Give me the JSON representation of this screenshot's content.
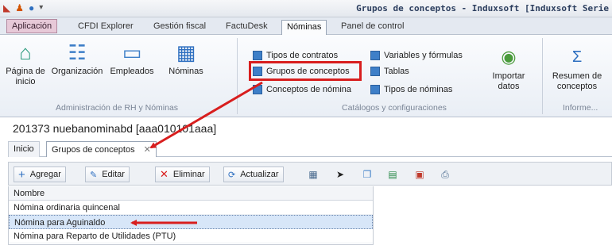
{
  "window": {
    "title": "Grupos de conceptos - Induxsoft [Induxsoft Serie"
  },
  "ribbon_tabs": [
    "Aplicación",
    "CFDI Explorer",
    "Gestión fiscal",
    "FactuDesk",
    "Nóminas",
    "Panel de control"
  ],
  "ribbon": {
    "big_buttons": [
      {
        "label": "Página de\ninicio",
        "icon": "home-icon"
      },
      {
        "label": "Organización",
        "icon": "org-chart-icon"
      },
      {
        "label": "Empleados",
        "icon": "folder-icon"
      },
      {
        "label": "Nóminas",
        "icon": "calendar-icon"
      }
    ],
    "small_buttons_col1": [
      "Tipos de contratos",
      "Grupos de conceptos",
      "Conceptos de nómina"
    ],
    "small_buttons_col2": [
      "Variables y fórmulas",
      "Tablas",
      "Tipos de nóminas"
    ],
    "import_label": "Importar\ndatos",
    "summary_label": "Resumen de\nconceptos",
    "group_labels": [
      "Administración de RH y Nóminas",
      "Catálogos y configuraciones",
      "Informe..."
    ]
  },
  "database": "201373 nuebanominabd [aaa010101aaa]",
  "doc_tabs": {
    "inicio": "Inicio",
    "grupos": "Grupos de conceptos",
    "close": "✕"
  },
  "toolbar": {
    "add": "Agregar",
    "edit": "Editar",
    "delete": "Eliminar",
    "refresh": "Actualizar"
  },
  "grid": {
    "header": "Nombre",
    "rows": [
      "Nómina ordinaria quincenal",
      "Nómina para Aguinaldo",
      "Nómina para Reparto de Utilidades (PTU)"
    ]
  },
  "colors": {
    "highlight": "#d81e1e",
    "selected_row": "#d7e6f8"
  }
}
